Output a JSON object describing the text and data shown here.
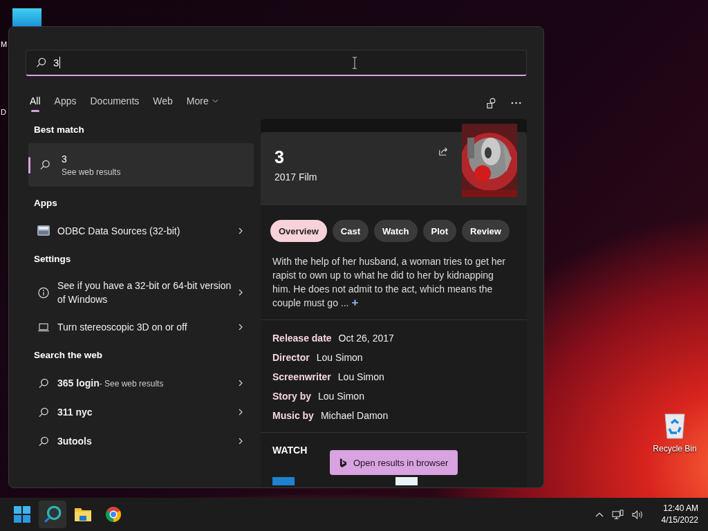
{
  "desktop": {
    "partial_labels": [
      "M",
      "D"
    ],
    "recycle_bin": "Recycle Bin"
  },
  "search": {
    "value": "3"
  },
  "tabs": [
    {
      "label": "All",
      "selected": true,
      "menu": false
    },
    {
      "label": "Apps",
      "selected": false,
      "menu": false
    },
    {
      "label": "Documents",
      "selected": false,
      "menu": false
    },
    {
      "label": "Web",
      "selected": false,
      "menu": false
    },
    {
      "label": "More",
      "selected": false,
      "menu": true
    }
  ],
  "best_match": {
    "heading": "Best match",
    "title": "3",
    "subtitle": "See web results",
    "selected": true
  },
  "sections": [
    {
      "heading": "Apps",
      "items": [
        {
          "kind": "app",
          "label": "ODBC Data Sources (32-bit)"
        }
      ]
    },
    {
      "heading": "Settings",
      "items": [
        {
          "kind": "info",
          "label": "See if you have a 32-bit or 64-bit version of Windows"
        },
        {
          "kind": "display",
          "label": "Turn stereoscopic 3D on or off"
        }
      ]
    },
    {
      "heading": "Search the web",
      "items": [
        {
          "kind": "web",
          "label": "365 login",
          "hint": "- See web results"
        },
        {
          "kind": "web",
          "label": "311 nyc"
        },
        {
          "kind": "web",
          "label": "3utools"
        }
      ]
    }
  ],
  "detail": {
    "title": "3",
    "subtitle": "2017 Film",
    "pills": [
      {
        "label": "Overview",
        "selected": true
      },
      {
        "label": "Cast",
        "selected": false
      },
      {
        "label": "Watch",
        "selected": false
      },
      {
        "label": "Plot",
        "selected": false
      },
      {
        "label": "Review",
        "selected": false
      }
    ],
    "description": "With the help of her husband, a woman tries to get her rapist to own up to what he did to her by kidnapping him. He does not admit to the act, which means the couple must go ...",
    "expand_label": "+",
    "facts": [
      {
        "label": "Release date",
        "value": "Oct 26, 2017"
      },
      {
        "label": "Director",
        "value": "Lou Simon"
      },
      {
        "label": "Screenwriter",
        "value": "Lou Simon"
      },
      {
        "label": "Story by",
        "value": "Lou Simon"
      },
      {
        "label": "Music by",
        "value": "Michael Damon"
      }
    ],
    "watch_heading": "WATCH"
  },
  "open_browser": "Open results in browser",
  "taskbar": {
    "apps": [
      {
        "kind": "start",
        "selected": false
      },
      {
        "kind": "search",
        "selected": true
      },
      {
        "kind": "explorer",
        "selected": false
      },
      {
        "kind": "chrome",
        "selected": false
      }
    ],
    "time": "12:40 AM",
    "date": "4/15/2022"
  }
}
